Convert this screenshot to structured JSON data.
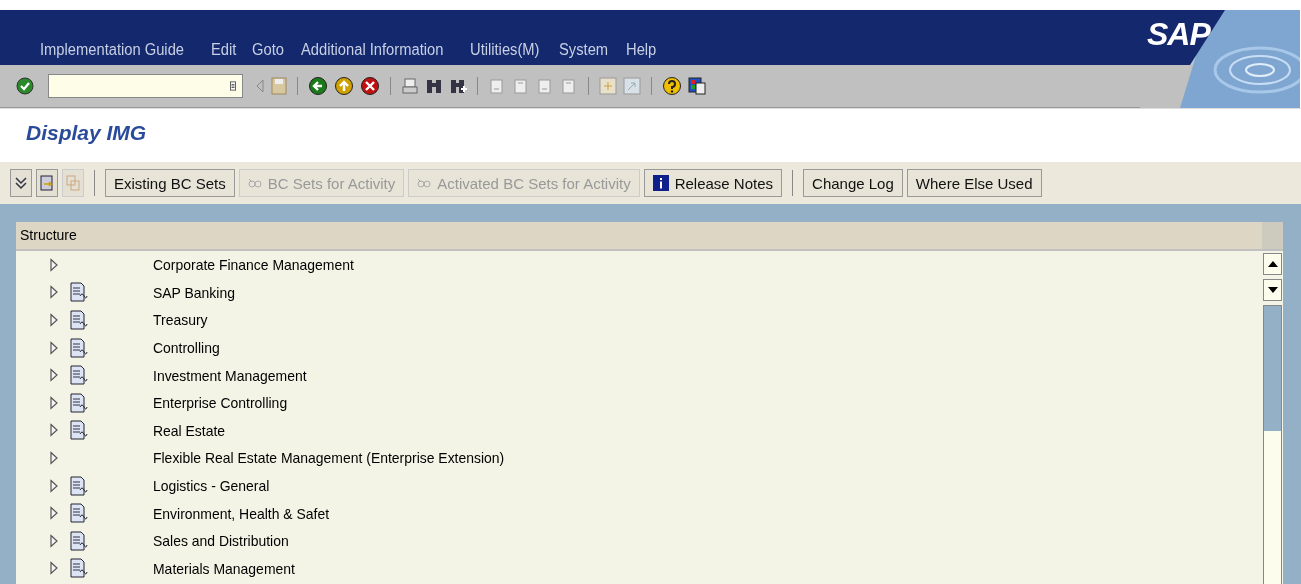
{
  "menu": [
    "Implementation Guide",
    "Edit",
    "Goto",
    "Additional Information",
    "Utilities(M)",
    "System",
    "Help"
  ],
  "logo": "SAP",
  "title": "Display IMG",
  "app_toolbar": [
    {
      "kind": "icon",
      "disabled": false
    },
    {
      "kind": "icon",
      "disabled": false
    },
    {
      "kind": "icon",
      "disabled": true
    },
    {
      "kind": "separator"
    },
    {
      "kind": "button",
      "label": "Existing BC Sets",
      "disabled": false
    },
    {
      "kind": "button",
      "label": "BC Sets for Activity",
      "disabled": true
    },
    {
      "kind": "button",
      "label": "Activated BC Sets for Activity",
      "disabled": true
    },
    {
      "kind": "button",
      "label": "Release Notes",
      "disabled": false
    },
    {
      "kind": "separator"
    },
    {
      "kind": "button",
      "label": "Change Log",
      "disabled": false
    },
    {
      "kind": "button",
      "label": "Where Else Used",
      "disabled": false
    }
  ],
  "tree": {
    "header": "Structure",
    "items": [
      {
        "label": "Corporate Finance Management",
        "kind": "node",
        "expanded": false
      },
      {
        "label": "SAP Banking",
        "kind": "activity",
        "expanded": false
      },
      {
        "label": "Treasury",
        "kind": "activity",
        "expanded": false
      },
      {
        "label": "Controlling",
        "kind": "activity",
        "expanded": false
      },
      {
        "label": "Investment Management",
        "kind": "activity",
        "expanded": false
      },
      {
        "label": "Enterprise Controlling",
        "kind": "activity",
        "expanded": false
      },
      {
        "label": "Real Estate",
        "kind": "activity",
        "expanded": false
      },
      {
        "label": "Flexible Real Estate Management (Enterprise Extension)",
        "kind": "node",
        "expanded": false
      },
      {
        "label": "Logistics - General",
        "kind": "activity",
        "expanded": false
      },
      {
        "label": "Environment, Health & Safet",
        "kind": "activity",
        "expanded": false
      },
      {
        "label": "Sales and Distribution",
        "kind": "activity",
        "expanded": false
      },
      {
        "label": "Materials Management",
        "kind": "activity",
        "expanded": false
      }
    ]
  }
}
